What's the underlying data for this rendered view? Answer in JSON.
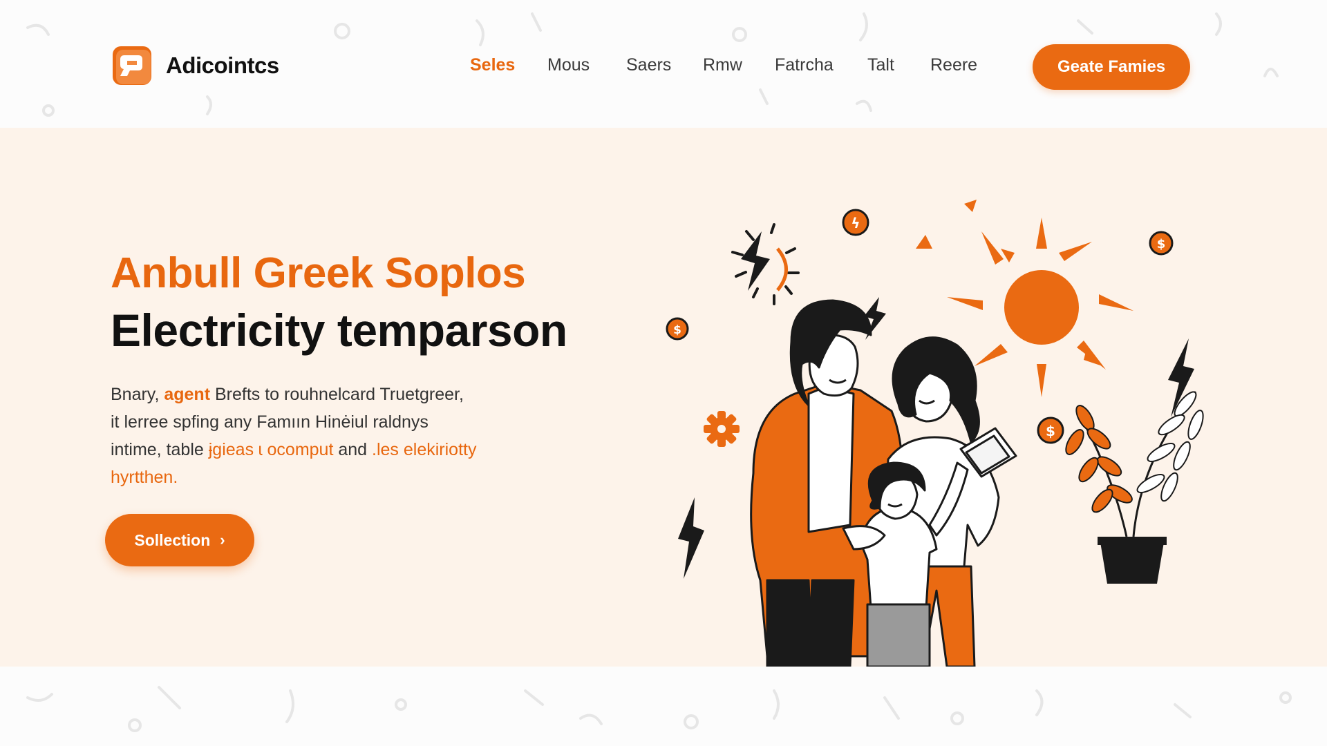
{
  "brand": {
    "name": "Adicointcs",
    "accent": "#ea6a12",
    "accent_text": "#e8670f",
    "hero_bg": "#fdf3ea"
  },
  "nav": {
    "items": [
      {
        "label": "Seles",
        "active": true
      },
      {
        "label": "Mous",
        "active": false
      },
      {
        "label": "Saers",
        "active": false
      },
      {
        "label": "Rmw",
        "active": false
      },
      {
        "label": "Fatrcha",
        "active": false
      },
      {
        "label": "Talt",
        "active": false
      },
      {
        "label": "Reere",
        "active": false
      }
    ],
    "cta_label": "Geate Famies"
  },
  "hero": {
    "headline_line1": "Anbull Greek Soplos",
    "headline_line2": "Electricity temparson",
    "paragraph": {
      "s1": "Bnary, ",
      "s2": "agent",
      "s3": " Brefts to rouhnelcard Truetgreer,",
      "s4": "it lerree spfing any Famıın Hinėiul raldnys",
      "s5": "intime, table ",
      "s6": "ɉgieas ɩ ocomput",
      "s7": " and ",
      "s8": ".les elekiriotty",
      "s9": "hyrtthen."
    },
    "cta_label": "Sollection",
    "cta_icon": "chevron-right-icon"
  },
  "illustration": {
    "subject": "family-with-tablet",
    "icons": [
      "sun-icon",
      "lightning-icon",
      "dollar-coin-icon",
      "gear-icon",
      "plant-icon"
    ]
  }
}
